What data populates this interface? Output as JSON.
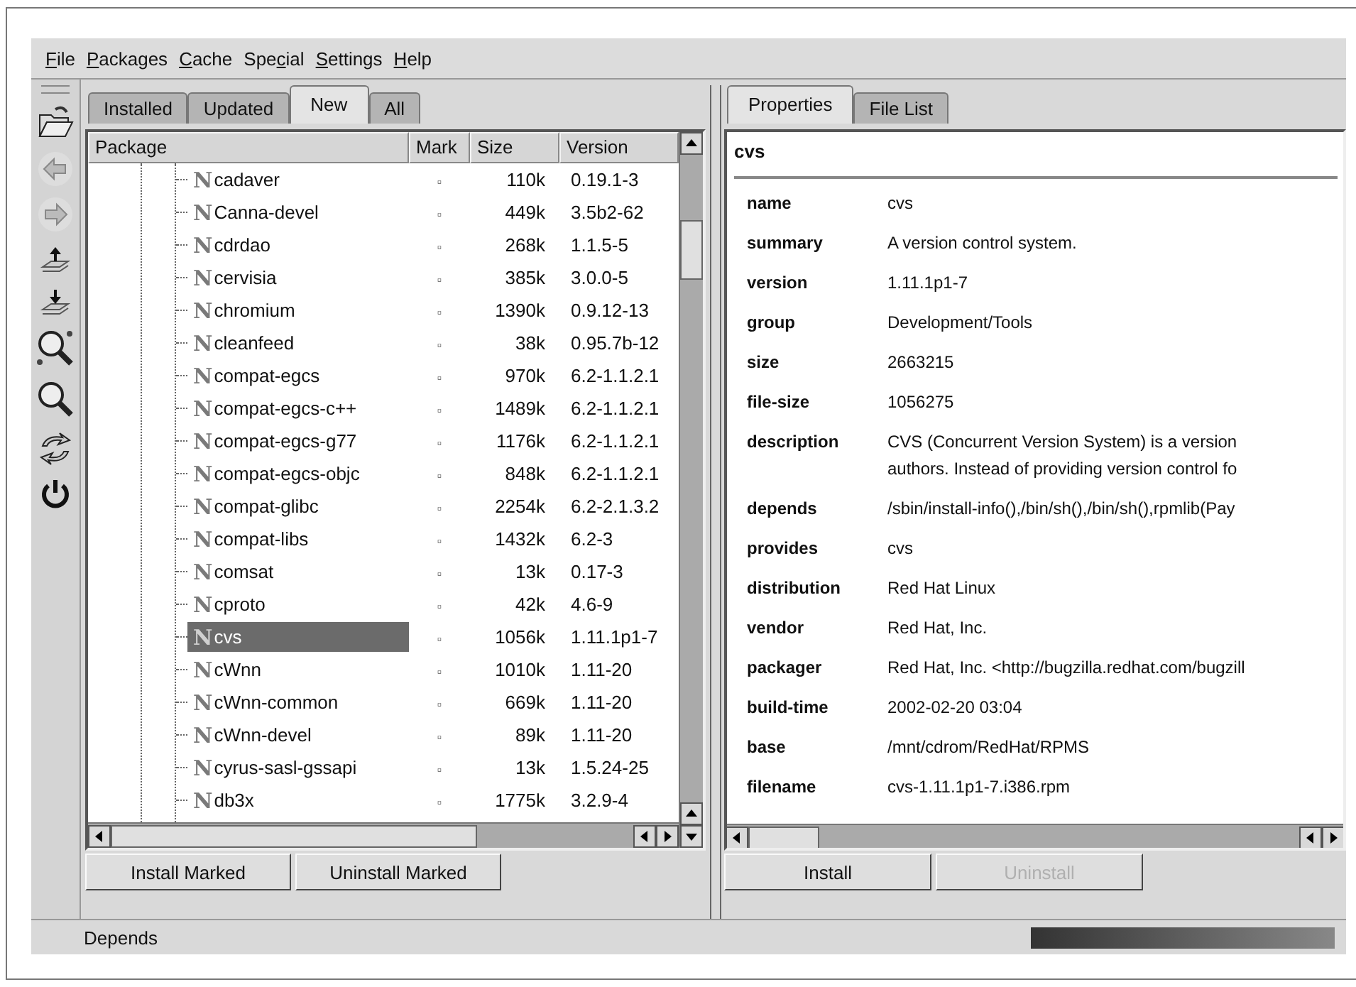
{
  "menu": [
    {
      "key": "F",
      "after": "ile"
    },
    {
      "key": "P",
      "after": "ackages"
    },
    {
      "key": "C",
      "after": "ache"
    },
    {
      "before": "Spe",
      "key": "c",
      "after": "ial"
    },
    {
      "key": "S",
      "after": "ettings"
    },
    {
      "key": "H",
      "after": "elp"
    }
  ],
  "toolbar": [
    {
      "kind": "folder"
    },
    {
      "kind": "back"
    },
    {
      "kind": "forward"
    },
    {
      "kind": "upload"
    },
    {
      "kind": "download"
    },
    {
      "kind": "find"
    },
    {
      "kind": "search"
    },
    {
      "kind": "refresh"
    },
    {
      "kind": "power"
    }
  ],
  "tabs": [
    {
      "label": "Installed",
      "selected": false
    },
    {
      "label": "Updated",
      "selected": false
    },
    {
      "label": "New",
      "selected": true
    },
    {
      "label": "All",
      "selected": false
    }
  ],
  "table": {
    "columns": [
      "Package",
      "Mark",
      "Size",
      "Version"
    ],
    "rows": [
      {
        "icon": "N",
        "name": "cadaver",
        "mark": "▫",
        "size": "110k",
        "version": "0.19.1-3",
        "selected": false
      },
      {
        "icon": "N",
        "name": "Canna-devel",
        "mark": "▫",
        "size": "449k",
        "version": "3.5b2-62",
        "selected": false
      },
      {
        "icon": "N",
        "name": "cdrdao",
        "mark": "▫",
        "size": "268k",
        "version": "1.1.5-5",
        "selected": false
      },
      {
        "icon": "N",
        "name": "cervisia",
        "mark": "▫",
        "size": "385k",
        "version": "3.0.0-5",
        "selected": false
      },
      {
        "icon": "N",
        "name": "chromium",
        "mark": "▫",
        "size": "1390k",
        "version": "0.9.12-13",
        "selected": false
      },
      {
        "icon": "N",
        "name": "cleanfeed",
        "mark": "▫",
        "size": "38k",
        "version": "0.95.7b-12",
        "selected": false
      },
      {
        "icon": "N",
        "name": "compat-egcs",
        "mark": "▫",
        "size": "970k",
        "version": "6.2-1.1.2.1",
        "selected": false
      },
      {
        "icon": "N",
        "name": "compat-egcs-c++",
        "mark": "▫",
        "size": "1489k",
        "version": "6.2-1.1.2.1",
        "selected": false
      },
      {
        "icon": "N",
        "name": "compat-egcs-g77",
        "mark": "▫",
        "size": "1176k",
        "version": "6.2-1.1.2.1",
        "selected": false
      },
      {
        "icon": "N",
        "name": "compat-egcs-objc",
        "mark": "▫",
        "size": "848k",
        "version": "6.2-1.1.2.1",
        "selected": false
      },
      {
        "icon": "N",
        "name": "compat-glibc",
        "mark": "▫",
        "size": "2254k",
        "version": "6.2-2.1.3.2",
        "selected": false
      },
      {
        "icon": "N",
        "name": "compat-libs",
        "mark": "▫",
        "size": "1432k",
        "version": "6.2-3",
        "selected": false
      },
      {
        "icon": "N",
        "name": "comsat",
        "mark": "▫",
        "size": "13k",
        "version": "0.17-3",
        "selected": false
      },
      {
        "icon": "N",
        "name": "cproto",
        "mark": "▫",
        "size": "42k",
        "version": "4.6-9",
        "selected": false
      },
      {
        "icon": "N",
        "name": "cvs",
        "mark": "▫",
        "size": "1056k",
        "version": "1.11.1p1-7",
        "selected": true
      },
      {
        "icon": "N",
        "name": "cWnn",
        "mark": "▫",
        "size": "1010k",
        "version": "1.11-20",
        "selected": false
      },
      {
        "icon": "N",
        "name": "cWnn-common",
        "mark": "▫",
        "size": "669k",
        "version": "1.11-20",
        "selected": false
      },
      {
        "icon": "N",
        "name": "cWnn-devel",
        "mark": "▫",
        "size": "89k",
        "version": "1.11-20",
        "selected": false
      },
      {
        "icon": "N",
        "name": "cyrus-sasl-gssapi",
        "mark": "▫",
        "size": "13k",
        "version": "1.5.24-25",
        "selected": false
      },
      {
        "icon": "N",
        "name": "db3x",
        "mark": "▫",
        "size": "1775k",
        "version": "3.2.9-4",
        "selected": false
      }
    ]
  },
  "left_buttons": [
    {
      "label": "Install Marked",
      "disabled": false
    },
    {
      "label": "Uninstall Marked",
      "disabled": false
    }
  ],
  "detail_tabs": [
    {
      "label": "Properties",
      "selected": true
    },
    {
      "label": "File List",
      "selected": false
    }
  ],
  "details": {
    "title": "cvs",
    "properties": [
      {
        "key": "name",
        "value": [
          "cvs"
        ]
      },
      {
        "key": "summary",
        "value": [
          "A version control system."
        ]
      },
      {
        "key": "version",
        "value": [
          "1.11.1p1-7"
        ]
      },
      {
        "key": "group",
        "value": [
          "Development/Tools"
        ]
      },
      {
        "key": "size",
        "value": [
          "2663215"
        ]
      },
      {
        "key": "file-size",
        "value": [
          "1056275"
        ]
      },
      {
        "key": "description",
        "value": [
          "CVS (Concurrent Version System) is a version",
          "authors. Instead of providing version control fo"
        ]
      },
      {
        "key": "depends",
        "value": [
          "/sbin/install-info(),/bin/sh(),/bin/sh(),rpmlib(Pay"
        ]
      },
      {
        "key": "provides",
        "value": [
          "cvs"
        ]
      },
      {
        "key": "distribution",
        "value": [
          "Red Hat Linux"
        ]
      },
      {
        "key": "vendor",
        "value": [
          "Red Hat, Inc."
        ]
      },
      {
        "key": "packager",
        "value": [
          "Red Hat, Inc. <http://bugzilla.redhat.com/bugzill"
        ]
      },
      {
        "key": "build-time",
        "value": [
          "2002-02-20 03:04"
        ]
      },
      {
        "key": "base",
        "value": [
          "/mnt/cdrom/RedHat/RPMS"
        ]
      },
      {
        "key": "filename",
        "value": [
          "cvs-1.11.1p1-7.i386.rpm"
        ]
      }
    ]
  },
  "right_buttons": [
    {
      "label": "Install",
      "disabled": false
    },
    {
      "label": "Uninstall",
      "disabled": true
    }
  ],
  "status_bar": {
    "text": "Depends",
    "progress": {
      "level": 1
    }
  }
}
